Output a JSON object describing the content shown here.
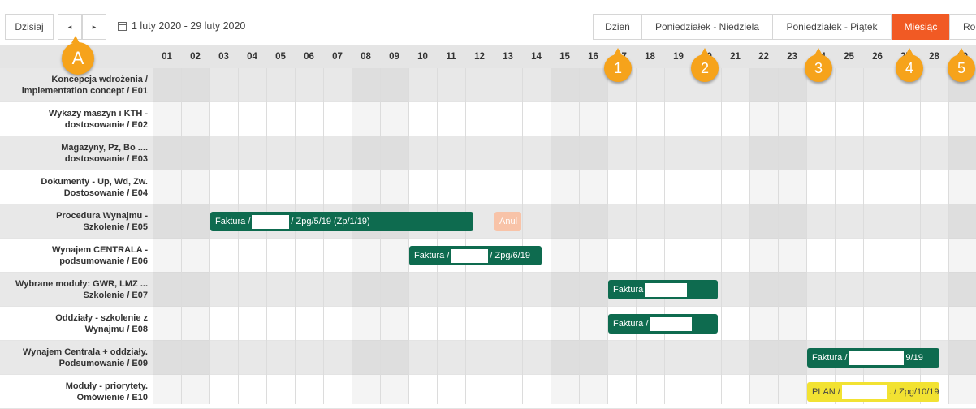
{
  "toolbar": {
    "today": "Dzisiaj",
    "prev": "◂",
    "next": "▸",
    "date_range": "1 luty 2020 - 29 luty 2020",
    "views": [
      {
        "label": "Dzień",
        "active": false
      },
      {
        "label": "Poniedziałek - Niedziela",
        "active": false
      },
      {
        "label": "Poniedziałek - Piątek",
        "active": false
      },
      {
        "label": "Miesiąc",
        "active": true
      },
      {
        "label": "Ro",
        "active": false
      }
    ]
  },
  "days": [
    "01",
    "02",
    "03",
    "04",
    "05",
    "06",
    "07",
    "08",
    "09",
    "10",
    "11",
    "12",
    "13",
    "14",
    "15",
    "16",
    "17",
    "18",
    "19",
    "20",
    "21",
    "22",
    "23",
    "24",
    "25",
    "26",
    "27",
    "28",
    "29"
  ],
  "rows": [
    {
      "line1": "Koncepcja wdrożenia /",
      "line2": "implementation concept / E01"
    },
    {
      "line1": "Wykazy maszyn i KTH -",
      "line2": "dostosowanie / E02"
    },
    {
      "line1": "Magazyny, Pz, Bo ....",
      "line2": "dostosowanie / E03"
    },
    {
      "line1": "Dokumenty - Up, Wd, Zw.",
      "line2": "Dostosowanie / E04"
    },
    {
      "line1": "Procedura Wynajmu -",
      "line2": "Szkolenie / E05"
    },
    {
      "line1": "Wynajem CENTRALA -",
      "line2": "podsumowanie / E06"
    },
    {
      "line1": "Wybrane moduły: GWR, LMZ ...",
      "line2": "Szkolenie / E07"
    },
    {
      "line1": "Oddziały - szkolenie z",
      "line2": "Wynajmu / E08"
    },
    {
      "line1": "Wynajem Centrala + oddziały.",
      "line2": "Podsumowanie / E09"
    },
    {
      "line1": "Moduły - priorytety.",
      "line2": "Omówienie / E10"
    }
  ],
  "events": [
    {
      "row": 4,
      "start": 3,
      "span": 9.3,
      "pre": "Faktura /",
      "post": "/ Zpg/5/19 (Zp/1/19)",
      "style": "green",
      "redact": 46
    },
    {
      "row": 4,
      "start": 13,
      "span": 1,
      "pre": "Anul",
      "post": "",
      "style": "peach",
      "redact": 0
    },
    {
      "row": 5,
      "start": 10,
      "span": 4.7,
      "pre": "Faktura /",
      "post": "/ Zpg/6/19",
      "style": "green",
      "redact": 46
    },
    {
      "row": 6,
      "start": 17,
      "span": 3.9,
      "pre": "Faktura",
      "post": "",
      "style": "green",
      "redact": 52
    },
    {
      "row": 7,
      "start": 17,
      "span": 3.9,
      "pre": "Faktura /",
      "post": "",
      "style": "green",
      "redact": 52
    },
    {
      "row": 8,
      "start": 24,
      "span": 4.7,
      "pre": "Faktura /",
      "post": "9/19",
      "style": "green",
      "redact": 68
    },
    {
      "row": 9,
      "start": 24,
      "span": 4.7,
      "pre": "PLAN /",
      "post": ". / Zpg/10/19",
      "style": "yellow",
      "redact": 58
    }
  ],
  "markers": [
    {
      "label": "A",
      "big": true
    },
    {
      "label": "1",
      "big": false
    },
    {
      "label": "2",
      "big": false
    },
    {
      "label": "3",
      "big": false
    },
    {
      "label": "4",
      "big": false
    },
    {
      "label": "5",
      "big": false
    }
  ],
  "colors": {
    "active_view": "#f15a24",
    "event_green": "#0e6b4f",
    "event_peach": "#f8c3a8",
    "event_yellow": "#f2e232",
    "marker": "#f6a31b"
  }
}
